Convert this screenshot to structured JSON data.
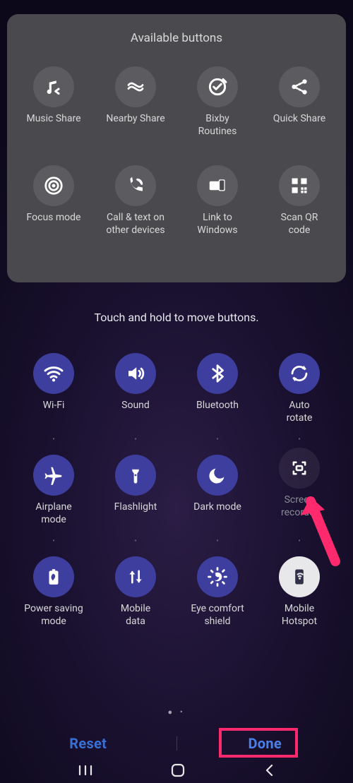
{
  "top": {
    "title": "Available buttons",
    "items": [
      {
        "label": "Music Share"
      },
      {
        "label": "Nearby Share"
      },
      {
        "label": "Bixby\nRoutines"
      },
      {
        "label": "Quick Share"
      },
      {
        "label": "Focus mode"
      },
      {
        "label": "Call & text on\nother devices"
      },
      {
        "label": "Link to\nWindows"
      },
      {
        "label": "Scan QR\ncode"
      }
    ]
  },
  "hint": "Touch and hold to move buttons.",
  "main": {
    "items": [
      {
        "label": "Wi-Fi"
      },
      {
        "label": "Sound"
      },
      {
        "label": "Bluetooth"
      },
      {
        "label": "Auto\nrotate"
      },
      {
        "label": "Airplane\nmode"
      },
      {
        "label": "Flashlight"
      },
      {
        "label": "Dark mode"
      },
      {
        "label": "Screen\nrecorder"
      },
      {
        "label": "Power saving\nmode"
      },
      {
        "label": "Mobile\ndata"
      },
      {
        "label": "Eye comfort\nshield"
      },
      {
        "label": "Mobile\nHotspot"
      }
    ]
  },
  "bottom": {
    "reset": "Reset",
    "done": "Done"
  }
}
